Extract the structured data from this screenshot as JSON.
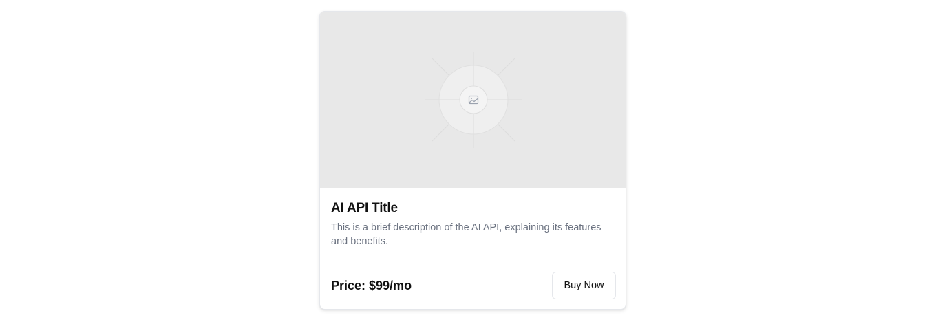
{
  "card": {
    "image_icon": "image-placeholder-icon",
    "title": "AI API Title",
    "description": "This is a brief description of the AI API, explaining its features and benefits.",
    "price": "Price: $99/mo",
    "buy_label": "Buy Now"
  }
}
